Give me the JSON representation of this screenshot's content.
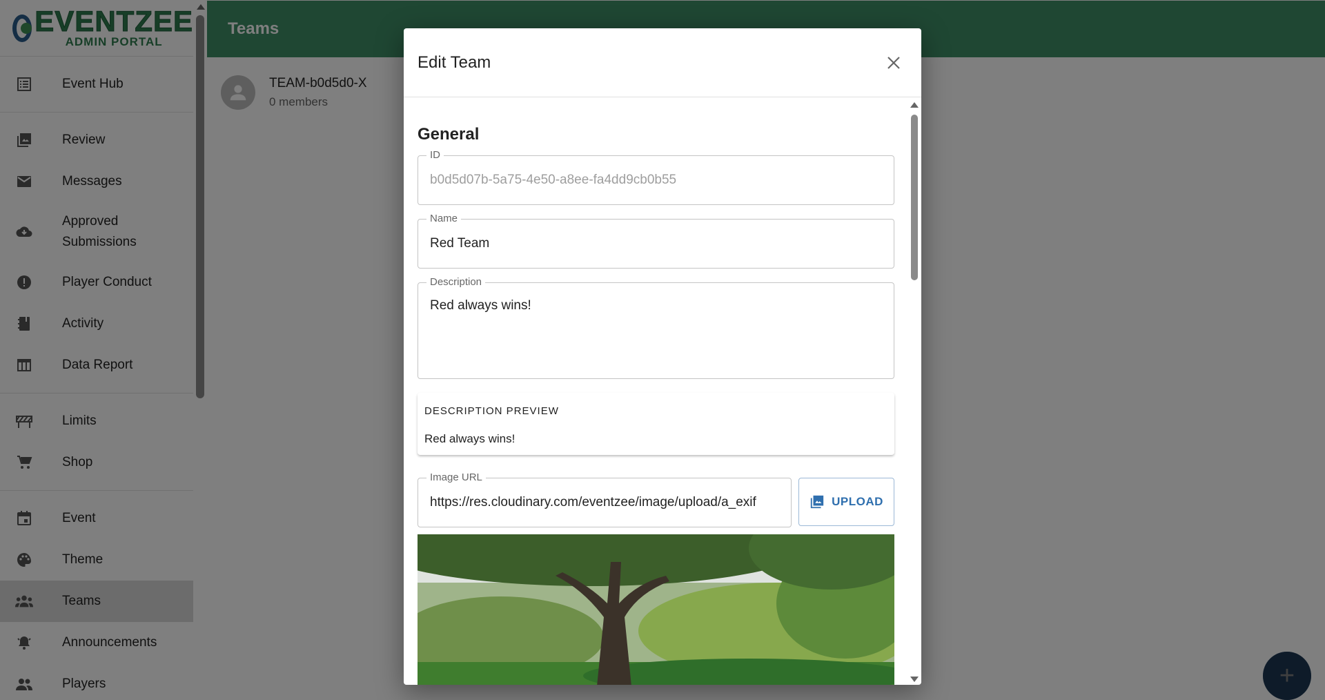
{
  "brand": {
    "name": "EVENTZEE",
    "subtitle": "ADMIN PORTAL",
    "primary_color": "#3f8e66",
    "accent_color": "#3a6fa5"
  },
  "sidebar": {
    "items": [
      {
        "label": "Event Hub",
        "icon": "list-icon"
      },
      {
        "label": "Review",
        "icon": "photo-library-icon"
      },
      {
        "label": "Messages",
        "icon": "mail-icon"
      },
      {
        "label": "Approved Submissions",
        "icon": "cloud-download-icon"
      },
      {
        "label": "Player Conduct",
        "icon": "alert-icon"
      },
      {
        "label": "Activity",
        "icon": "notebook-icon"
      },
      {
        "label": "Data Report",
        "icon": "table-icon"
      },
      {
        "label": "Limits",
        "icon": "barrier-icon"
      },
      {
        "label": "Shop",
        "icon": "cart-icon"
      },
      {
        "label": "Event",
        "icon": "calendar-icon"
      },
      {
        "label": "Theme",
        "icon": "palette-icon"
      },
      {
        "label": "Teams",
        "icon": "groups-icon",
        "active": true
      },
      {
        "label": "Announcements",
        "icon": "bell-icon"
      },
      {
        "label": "Players",
        "icon": "people-icon"
      }
    ]
  },
  "header": {
    "title": "Teams"
  },
  "teams": [
    {
      "name": "TEAM-b0d5d0-X",
      "members": "0 members"
    }
  ],
  "dialog": {
    "title": "Edit Team",
    "section_title": "General",
    "id_label": "ID",
    "id_value": "b0d5d07b-5a75-4e50-a8ee-fa4dd9cb0b55",
    "name_label": "Name",
    "name_value": "Red Team",
    "description_label": "Description",
    "description_value": "Red always wins!",
    "preview_title": "DESCRIPTION PREVIEW",
    "preview_text": "Red always wins!",
    "image_url_label": "Image URL",
    "image_url_value": "https://res.cloudinary.com/eventzee/image/upload/a_exif",
    "upload_label": "UPLOAD"
  },
  "fab": {
    "icon": "plus-icon",
    "label": "+"
  }
}
